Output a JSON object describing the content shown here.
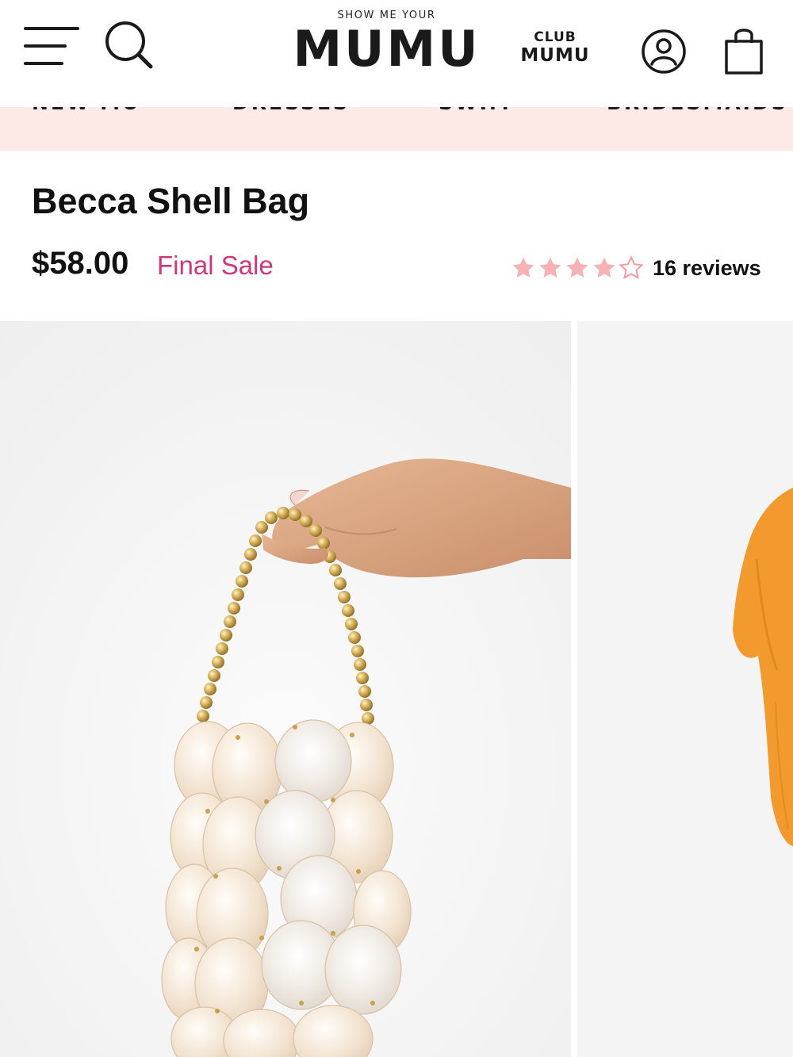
{
  "header": {
    "logo_tagline": "SHOW ME YOUR",
    "logo_wordmark": "MUMU",
    "club_line1": "CLUB",
    "club_line2": "MUMU",
    "icons": [
      "hamburger-menu-icon",
      "search-icon",
      "user-account-icon",
      "shopping-bag-icon"
    ]
  },
  "nav": {
    "items": [
      "NEW MU",
      "DRESSES",
      "SWIM",
      "BRIDESMAIDS"
    ],
    "background": "#fbeae6"
  },
  "product": {
    "title": "Becca Shell Bag",
    "price": "$58.00",
    "sale_label": "Final Sale",
    "rating": 4,
    "rating_max": 5,
    "reviews_label": "16 reviews"
  },
  "colors": {
    "sale_text": "#d2367a",
    "star_fill": "#f7b2b4",
    "text": "#111111"
  }
}
